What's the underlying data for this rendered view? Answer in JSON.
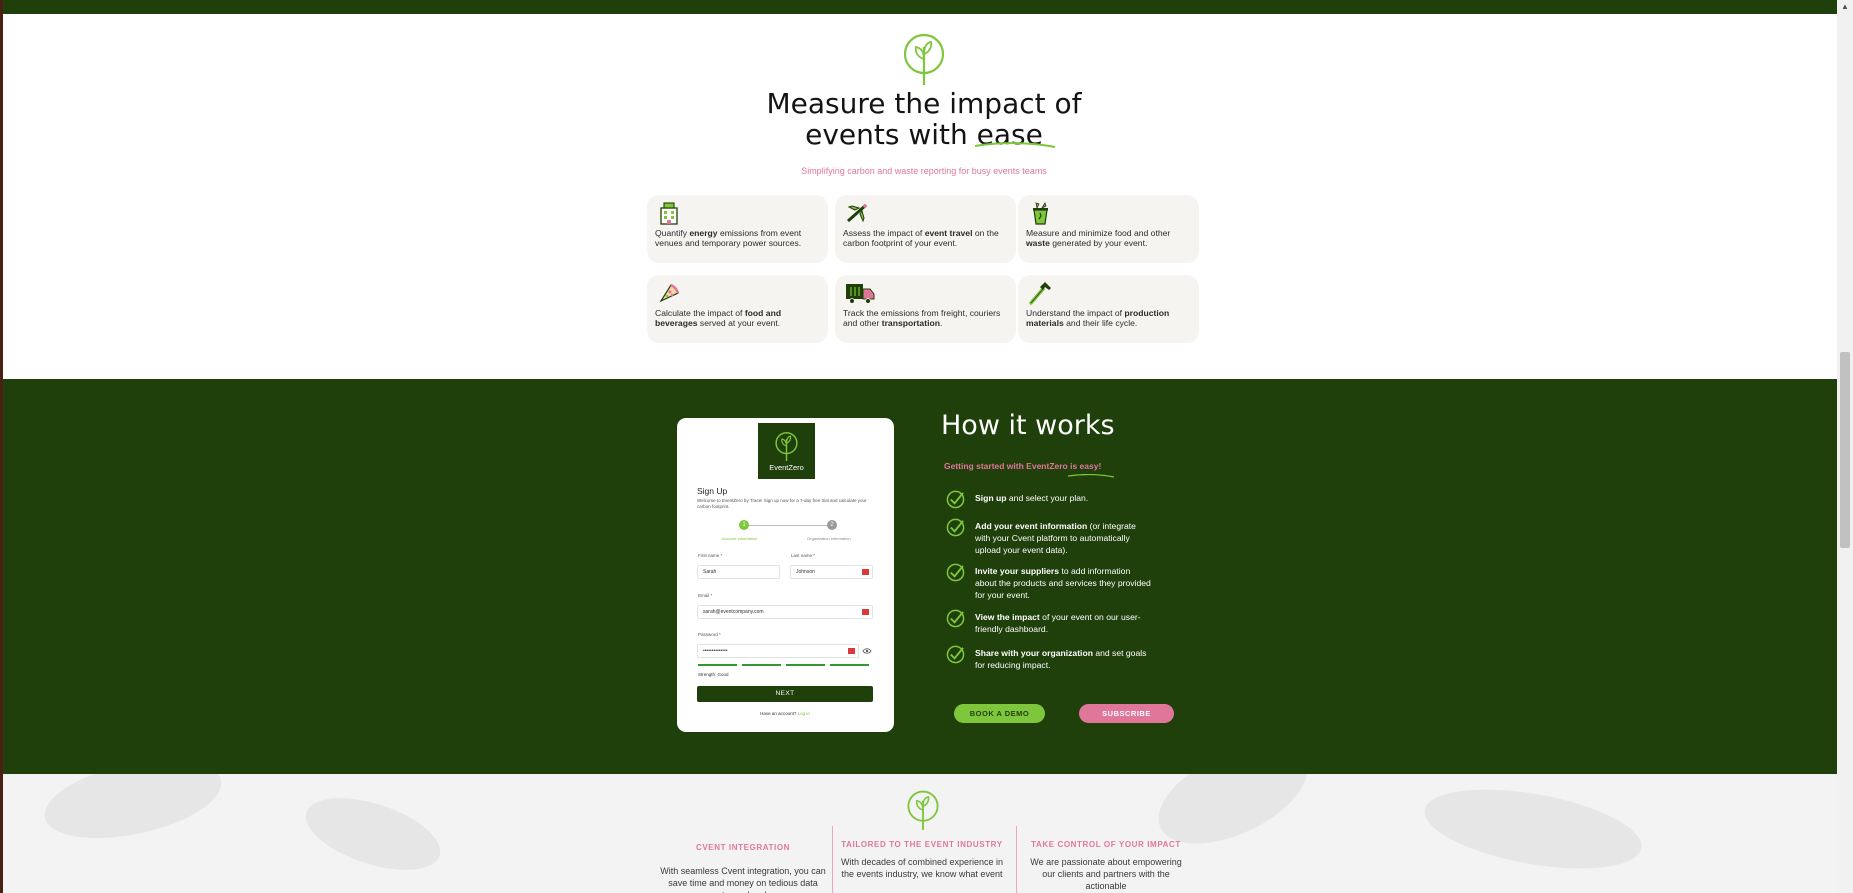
{
  "colors": {
    "dark_green": "#1f3f0b",
    "lime": "#7ec63b",
    "pink": "#e0779a",
    "card_bg": "#f6f4f1"
  },
  "impact": {
    "logo_icon": "sprout-icon",
    "headline_line1": "Measure the impact of",
    "headline_line2_a": "events with ",
    "headline_line2_b": "ease",
    "subtitle": "Simplifying carbon and waste reporting for busy events teams",
    "cards": [
      {
        "icon": "building-icon",
        "pre": "Quantify ",
        "bold": "energy",
        "post": " emissions from event venues and temporary power sources."
      },
      {
        "icon": "airplane-icon",
        "pre": "Assess the impact of ",
        "bold": "event travel",
        "post": " on the carbon footprint of your  event."
      },
      {
        "icon": "waste-bin-icon",
        "pre": "Measure and minimize food and other ",
        "bold": "waste",
        "post": " generated by your event."
      },
      {
        "icon": "pizza-icon",
        "pre": "Calculate the impact of ",
        "bold": "food and beverages",
        "post": " served at your event."
      },
      {
        "icon": "truck-icon",
        "pre": "Track the emissions from freight, couriers and other ",
        "bold": "transportation",
        "post": "."
      },
      {
        "icon": "hammer-icon",
        "pre": "Understand the impact of ",
        "bold": "production materials",
        "post": " and their life cycle."
      }
    ]
  },
  "signup": {
    "brand": "EventZero",
    "title": "Sign Up",
    "description": "Welcome to EventZero by Trace! Sign up now for a 7-day free trial and calculate your carbon footprint.",
    "step1_num": "1",
    "step2_num": "2",
    "step1_label": "Account information",
    "step2_label": "Organization information",
    "first_name_label": "First name *",
    "first_name_value": "Sarah",
    "last_name_label": "Last name *",
    "last_name_value": "Johnson",
    "email_label": "Email *",
    "email_value": "sarah@eventcompany.com",
    "password_label": "Password *",
    "password_value": "••••••••••••••",
    "strength": "Strength: Good",
    "next": "NEXT",
    "have_account": "Have an account? ",
    "login": "Log in"
  },
  "how": {
    "title": "How it works",
    "subtitle": "Getting started with EventZero is easy!",
    "items": [
      {
        "bold": "Sign up",
        "rest": " and select your plan."
      },
      {
        "bold": "Add your event information",
        "rest": " (or integrate with your Cvent platform to automatically upload your event data)."
      },
      {
        "bold": "Invite your suppliers",
        "rest": " to add information  about the products and services they provided for your event."
      },
      {
        "bold": "View the impact",
        "rest": " of your event on our user-friendly dashboard."
      },
      {
        "bold": "Share with your organization",
        "rest": " and set goals for reducing impact."
      }
    ],
    "book_demo": "BOOK A DEMO",
    "subscribe": "SUBSCRIBE"
  },
  "features": [
    {
      "title": "CVENT INTEGRATION",
      "text": "With seamless Cvent integration, you can save time and money on tedious data entry and make"
    },
    {
      "title": "TAILORED TO THE EVENT INDUSTRY",
      "text": "With decades of combined experience in the events industry, we know what event"
    },
    {
      "title": "TAKE CONTROL OF YOUR IMPACT",
      "text": "We are passionate about empowering our clients and partners with the actionable"
    }
  ]
}
